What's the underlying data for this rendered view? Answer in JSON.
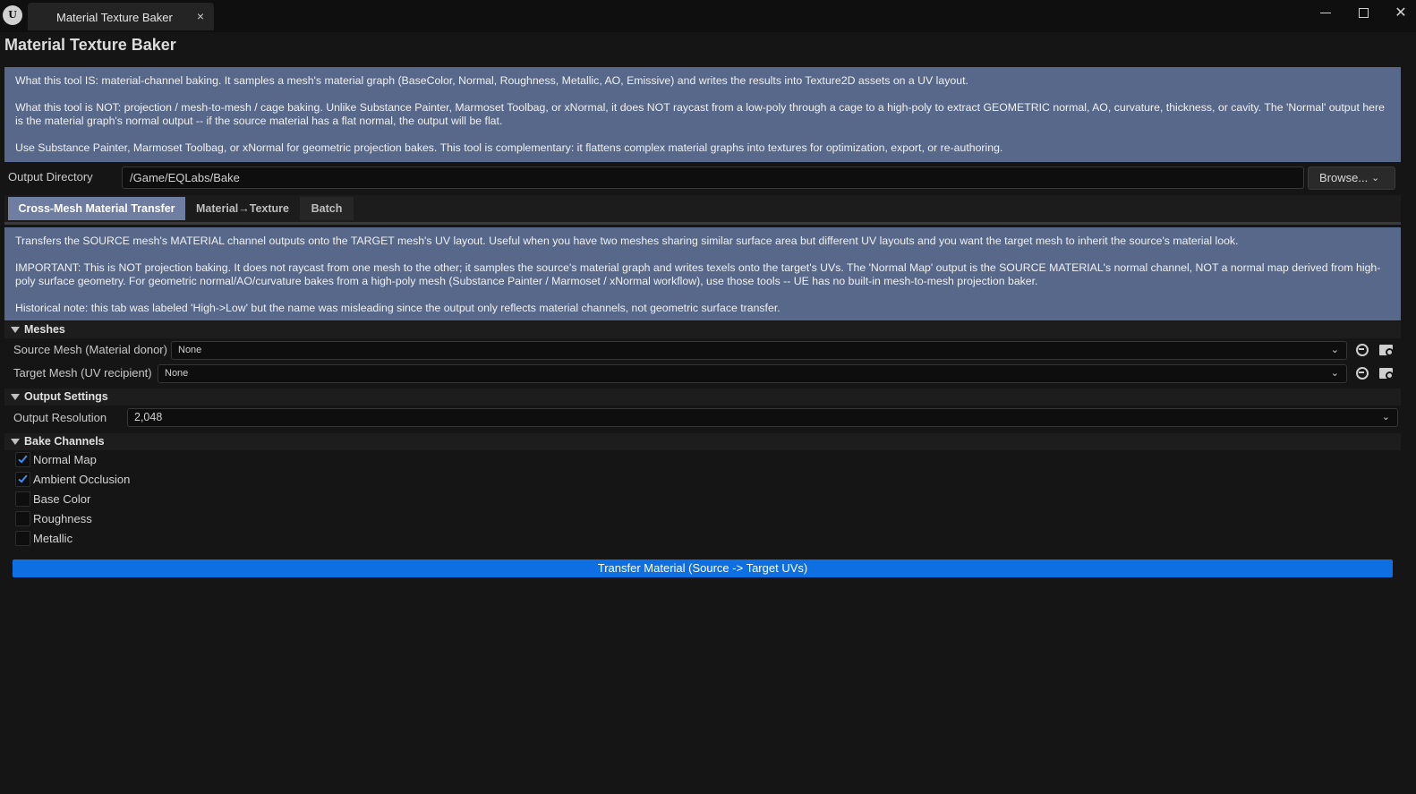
{
  "window": {
    "logo_text": "U",
    "tab_title": "Material Texture Baker",
    "tab_close": "×",
    "close_glyph": "✕"
  },
  "page_title": "Material Texture Baker",
  "intro": {
    "p1": "What this tool IS: material-channel baking. It samples a mesh's material graph (BaseColor, Normal, Roughness, Metallic, AO, Emissive) and writes the results into Texture2D assets on a UV layout.",
    "p2": "What this tool is NOT: projection / mesh-to-mesh / cage baking. Unlike Substance Painter, Marmoset Toolbag, or xNormal, it does NOT raycast from a low-poly through a cage to a high-poly to extract GEOMETRIC normal, AO, curvature, thickness, or cavity. The 'Normal' output here is the material graph's normal output -- if the source material has a flat normal, the output will be flat.",
    "p3": "Use Substance Painter, Marmoset Toolbag, or xNormal for geometric projection bakes. This tool is complementary: it flattens complex material graphs into textures for optimization, export, or re-authoring."
  },
  "output_directory": {
    "label": "Output Directory",
    "value": "/Game/EQLabs/Bake",
    "browse_label": "Browse...",
    "chevron": "⌄"
  },
  "tabs": [
    {
      "label": "Cross-Mesh Material Transfer",
      "active": true
    },
    {
      "label": "Material→Texture",
      "active": false
    },
    {
      "label": "Batch",
      "active": false
    }
  ],
  "tab_info": {
    "p1": "Transfers the SOURCE mesh's MATERIAL channel outputs onto the TARGET mesh's UV layout. Useful when you have two meshes sharing similar surface area but different UV layouts and you want the target mesh to inherit the source's material look.",
    "p2": "IMPORTANT: This is NOT projection baking. It does not raycast from one mesh to the other; it samples the source's material graph and writes texels onto the target's UVs. The 'Normal Map' output is the SOURCE MATERIAL's normal channel, NOT a normal map derived from high-poly surface geometry. For geometric normal/AO/curvature bakes from a high-poly mesh (Substance Painter / Marmoset / xNormal workflow), use those tools -- UE has no built-in mesh-to-mesh projection baker.",
    "p3": "Historical note: this tab was labeled 'High->Low' but the name was misleading since the output only reflects material channels, not geometric surface transfer."
  },
  "meshes": {
    "section_label": "Meshes",
    "source_label": "Source Mesh (Material donor)",
    "source_value": "None",
    "target_label": "Target Mesh (UV recipient)",
    "target_value": "None"
  },
  "output_settings": {
    "section_label": "Output Settings",
    "resolution_label": "Output Resolution",
    "resolution_value": "2,048"
  },
  "bake_channels": {
    "section_label": "Bake Channels",
    "items": [
      {
        "label": "Normal Map",
        "checked": true
      },
      {
        "label": "Ambient Occlusion",
        "checked": true
      },
      {
        "label": "Base Color",
        "checked": false
      },
      {
        "label": "Roughness",
        "checked": false
      },
      {
        "label": "Metallic",
        "checked": false
      }
    ]
  },
  "primary_action": "Transfer Material (Source -> Target UVs)",
  "colors": {
    "accent": "#0e6fe2",
    "info_bg": "#58688a",
    "active_tab": "#6f7da3",
    "check": "#3d8ef0",
    "background": "#151515"
  },
  "icons": [
    "unreal-logo",
    "close-icon",
    "minimize-icon",
    "maximize-icon",
    "chevron-down-icon",
    "use-selected-icon",
    "browse-asset-icon",
    "checkmark-icon",
    "collapse-triangle-icon"
  ]
}
